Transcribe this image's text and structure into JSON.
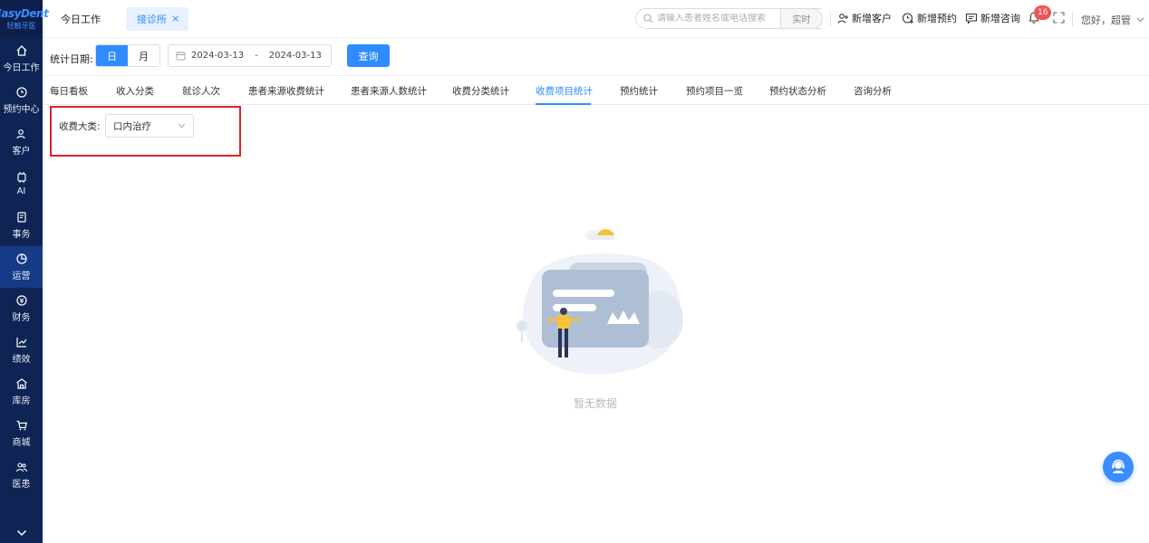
{
  "brand": {
    "name": "EasyDent",
    "subtitle": "轻触牙医"
  },
  "sidebar": {
    "items": [
      {
        "label": "今日工作",
        "icon": "home-icon"
      },
      {
        "label": "预约中心",
        "icon": "clock-icon"
      },
      {
        "label": "客户",
        "icon": "user-icon"
      },
      {
        "label": "AI",
        "icon": "ai-chip-icon"
      },
      {
        "label": "事务",
        "icon": "document-icon"
      },
      {
        "label": "运营",
        "icon": "pie-chart-icon",
        "active": true
      },
      {
        "label": "财务",
        "icon": "money-icon"
      },
      {
        "label": "绩效",
        "icon": "line-chart-icon"
      },
      {
        "label": "库房",
        "icon": "warehouse-icon"
      },
      {
        "label": "商城",
        "icon": "cart-icon"
      },
      {
        "label": "医患",
        "icon": "people-icon"
      }
    ],
    "more_icon": "chevron-down-icon"
  },
  "topbar": {
    "tabs": [
      {
        "label": "今日工作"
      },
      {
        "label": "接诊所",
        "active": true,
        "close": "×"
      }
    ],
    "search": {
      "placeholder": "请输入患者姓名或电话搜索",
      "button": "实时"
    },
    "actions": [
      {
        "label": "新增客户",
        "icon": "add-user-icon"
      },
      {
        "label": "新增预约",
        "icon": "add-clock-icon"
      },
      {
        "label": "新增咨询",
        "icon": "chat-icon"
      }
    ],
    "notifications": {
      "count": "16",
      "icon": "bell-icon"
    },
    "greeting": "您好，超管"
  },
  "filter": {
    "label": "统计日期:",
    "modes": [
      {
        "label": "日",
        "active": true
      },
      {
        "label": "月",
        "active": false
      }
    ],
    "date_start": "2024-03-13",
    "date_sep": "-",
    "date_end": "2024-03-13",
    "query_button": "查询"
  },
  "subtabs": {
    "items": [
      {
        "label": "每日看板"
      },
      {
        "label": "收入分类"
      },
      {
        "label": "就诊人次"
      },
      {
        "label": "患者来源收费统计"
      },
      {
        "label": "患者来源人数统计"
      },
      {
        "label": "收费分类统计"
      },
      {
        "label": "收费项目统计",
        "active": true
      },
      {
        "label": "预约统计"
      },
      {
        "label": "预约项目一览"
      },
      {
        "label": "预约状态分析"
      },
      {
        "label": "咨询分析"
      }
    ]
  },
  "category": {
    "label": "收费大类:",
    "value": "口内治疗"
  },
  "empty": {
    "text": "暂无数据"
  },
  "colors": {
    "accent": "#2f8cff",
    "sidebar_bg": "#0e2454",
    "highlight_border": "#d7262c",
    "badge": "#f05454"
  }
}
